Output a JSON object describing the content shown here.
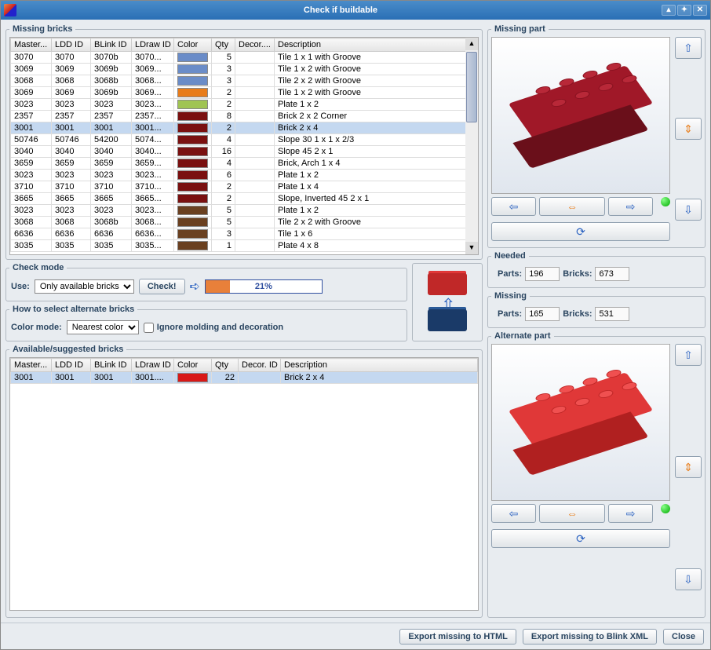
{
  "window": {
    "title": "Check if buildable"
  },
  "missing_bricks": {
    "legend": "Missing bricks",
    "headers": [
      "Master...",
      "LDD ID",
      "BLink ID",
      "LDraw ID",
      "Color",
      "Qty",
      "Decor....",
      "Description"
    ],
    "rows": [
      {
        "m": "3070",
        "l": "3070",
        "b": "3070b",
        "w": "3070...",
        "c": "#6a8cc8",
        "q": 5,
        "d": "",
        "desc": "Tile 1 x 1 with Groove"
      },
      {
        "m": "3069",
        "l": "3069",
        "b": "3069b",
        "w": "3069...",
        "c": "#6a8cc8",
        "q": 3,
        "d": "",
        "desc": "Tile 1 x 2 with Groove"
      },
      {
        "m": "3068",
        "l": "3068",
        "b": "3068b",
        "w": "3068...",
        "c": "#6a8cc8",
        "q": 3,
        "d": "",
        "desc": "Tile 2 x 2 with Groove"
      },
      {
        "m": "3069",
        "l": "3069",
        "b": "3069b",
        "w": "3069...",
        "c": "#e87c1a",
        "q": 2,
        "d": "",
        "desc": "Tile 1 x 2 with Groove"
      },
      {
        "m": "3023",
        "l": "3023",
        "b": "3023",
        "w": "3023...",
        "c": "#a0c452",
        "q": 2,
        "d": "",
        "desc": "Plate 1 x 2"
      },
      {
        "m": "2357",
        "l": "2357",
        "b": "2357",
        "w": "2357...",
        "c": "#7a1010",
        "q": 8,
        "d": "",
        "desc": "Brick 2 x 2 Corner"
      },
      {
        "m": "3001",
        "l": "3001",
        "b": "3001",
        "w": "3001...",
        "c": "#7a1010",
        "q": 2,
        "d": "",
        "desc": "Brick 2 x 4",
        "sel": true
      },
      {
        "m": "50746",
        "l": "50746",
        "b": "54200",
        "w": "5074...",
        "c": "#7a1010",
        "q": 4,
        "d": "",
        "desc": "Slope 30 1 x 1 x 2/3"
      },
      {
        "m": "3040",
        "l": "3040",
        "b": "3040",
        "w": "3040...",
        "c": "#7a1010",
        "q": 16,
        "d": "",
        "desc": "Slope 45 2 x 1"
      },
      {
        "m": "3659",
        "l": "3659",
        "b": "3659",
        "w": "3659...",
        "c": "#7a1010",
        "q": 4,
        "d": "",
        "desc": "Brick, Arch 1 x 4"
      },
      {
        "m": "3023",
        "l": "3023",
        "b": "3023",
        "w": "3023...",
        "c": "#7a1010",
        "q": 6,
        "d": "",
        "desc": "Plate 1 x 2"
      },
      {
        "m": "3710",
        "l": "3710",
        "b": "3710",
        "w": "3710...",
        "c": "#7a1010",
        "q": 2,
        "d": "",
        "desc": "Plate 1 x 4"
      },
      {
        "m": "3665",
        "l": "3665",
        "b": "3665",
        "w": "3665...",
        "c": "#7a1010",
        "q": 2,
        "d": "",
        "desc": "Slope, Inverted 45 2 x 1"
      },
      {
        "m": "3023",
        "l": "3023",
        "b": "3023",
        "w": "3023...",
        "c": "#6a4020",
        "q": 5,
        "d": "",
        "desc": "Plate 1 x 2"
      },
      {
        "m": "3068",
        "l": "3068",
        "b": "3068b",
        "w": "3068...",
        "c": "#6a4020",
        "q": 5,
        "d": "",
        "desc": "Tile 2 x 2 with Groove"
      },
      {
        "m": "6636",
        "l": "6636",
        "b": "6636",
        "w": "6636...",
        "c": "#6a4020",
        "q": 3,
        "d": "",
        "desc": "Tile 1 x 6"
      },
      {
        "m": "3035",
        "l": "3035",
        "b": "3035",
        "w": "3035...",
        "c": "#6a4020",
        "q": 1,
        "d": "",
        "desc": "Plate 4 x 8"
      }
    ]
  },
  "check_mode": {
    "legend": "Check mode",
    "use_label": "Use:",
    "use_value": "Only available bricks",
    "check_button": "Check!",
    "progress_pct": 21,
    "progress_text": "21%"
  },
  "alt_select": {
    "legend": "How to select alternate bricks",
    "color_label": "Color mode:",
    "color_value": "Nearest color",
    "ignore_label": "Ignore molding and decoration",
    "ignore_checked": false
  },
  "available": {
    "legend": "Available/suggested bricks",
    "headers": [
      "Master...",
      "LDD ID",
      "BLink ID",
      "LDraw ID",
      "Color",
      "Qty",
      "Decor. ID",
      "Description"
    ],
    "rows": [
      {
        "m": "3001",
        "l": "3001",
        "b": "3001",
        "w": "3001....",
        "c": "#d81818",
        "q": 22,
        "d": "",
        "desc": "Brick 2 x 4",
        "sel": true
      }
    ]
  },
  "missing_part": {
    "legend": "Missing part"
  },
  "needed": {
    "legend": "Needed",
    "parts_label": "Parts:",
    "parts": "196",
    "bricks_label": "Bricks:",
    "bricks": "673"
  },
  "missing": {
    "legend": "Missing",
    "parts_label": "Parts:",
    "parts": "165",
    "bricks_label": "Bricks:",
    "bricks": "531"
  },
  "alternate_part": {
    "legend": "Alternate part"
  },
  "footer": {
    "export_html": "Export missing to HTML",
    "export_xml": "Export missing to Blink XML",
    "close": "Close"
  }
}
